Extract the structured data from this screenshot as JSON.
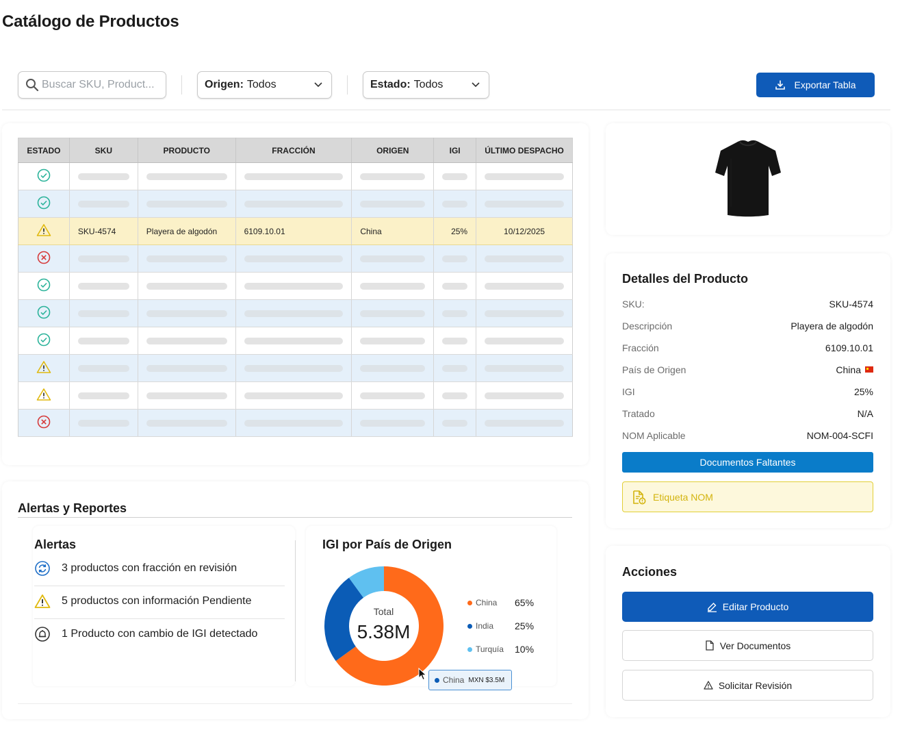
{
  "page": {
    "title": "Catálogo de Productos"
  },
  "toolbar": {
    "search_placeholder": "Buscar SKU, Product...",
    "origin_label": "Origen:",
    "origin_value": "Todos",
    "status_label": "Estado:",
    "status_value": "Todos",
    "export_label": "Exportar Tabla"
  },
  "table": {
    "headers": [
      "ESTADO",
      "SKU",
      "PRODUCTO",
      "FRACCIÓN",
      "ORIGEN",
      "IGI",
      "ÚLTIMO DESPACHO"
    ],
    "row_statuses": [
      "ok",
      "ok",
      "warning",
      "error",
      "ok",
      "ok",
      "ok",
      "warning",
      "warning",
      "error"
    ],
    "selected_row": {
      "sku": "SKU-4574",
      "producto": "Playera de algodón",
      "fraccion": "6109.10.01",
      "origen": "China",
      "igi": "25%",
      "ultimo_despacho": "10/12/2025"
    }
  },
  "details": {
    "title": "Detalles del Producto",
    "rows": [
      {
        "label": "SKU:",
        "value": "SKU-4574"
      },
      {
        "label": "Descripción",
        "value": "Playera de algodón"
      },
      {
        "label": "Fracción",
        "value": "6109.10.01"
      },
      {
        "label": "País de Origen",
        "value": "China"
      },
      {
        "label": "IGI",
        "value": "25%"
      },
      {
        "label": "Tratado",
        "value": "N/A"
      },
      {
        "label": "NOM Aplicable",
        "value": "NOM-004-SCFI"
      }
    ],
    "missing_docs_label": "Documentos Faltantes",
    "nom_label": "Etiqueta NOM"
  },
  "actions": {
    "title": "Acciones",
    "edit_label": "Editar Producto",
    "view_docs_label": "Ver Documentos",
    "request_review_label": "Solicitar Revisión"
  },
  "alerts": {
    "section_title": "Alertas y Reportes",
    "list_title": "Alertas",
    "items": [
      {
        "icon": "sync-icon",
        "text": "3 productos con fracción en revisión"
      },
      {
        "icon": "warning-icon",
        "text": "5 productos con información Pendiente"
      },
      {
        "icon": "alarm-bell-icon",
        "text": "1 Producto con cambio de IGI detectado"
      }
    ]
  },
  "colors": {
    "primary": "#0f5bb8",
    "info": "#0a7cc9",
    "ok": "#2bb39a",
    "warning": "#e0b90f",
    "error": "#d63a3a"
  },
  "chart_data": {
    "type": "pie",
    "title": "IGI por País de Origen",
    "center_label": "Total",
    "center_value": "5.38M",
    "slices": [
      {
        "name": "China",
        "value": 65,
        "label": "65%",
        "color": "#ff6a1a"
      },
      {
        "name": "India",
        "value": 25,
        "label": "25%",
        "color": "#0b5cb6"
      },
      {
        "name": "Turquía",
        "value": 10,
        "label": "10%",
        "color": "#5fc0f0"
      }
    ],
    "tooltip": {
      "name": "China",
      "value": "MXN $3.5M"
    }
  }
}
